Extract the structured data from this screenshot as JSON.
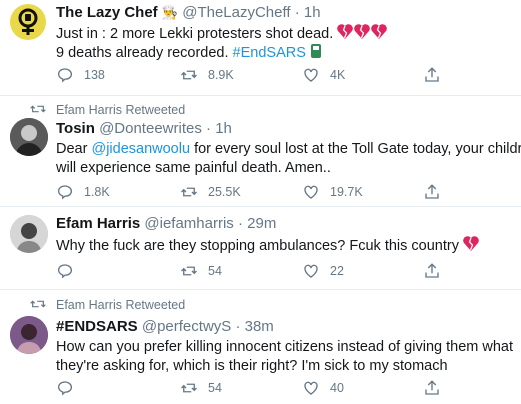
{
  "tweets": [
    {
      "name": "The Lazy Chef",
      "chef_glyph": "👨‍🍳",
      "handle": "@TheLazyCheff",
      "dot": "·",
      "time": "1h",
      "line1": "Just in : 2 more Lekki protesters shot dead.",
      "line2_plain": "9 deaths already recorded.",
      "line2_tag": "#EndSARS",
      "reply_count": "138",
      "retweet_count": "8.9K",
      "like_count": "4K"
    },
    {
      "retweeted_by": "Efam Harris Retweeted",
      "name": "Tosin",
      "handle": "@Donteewrites",
      "dot": "·",
      "time": "1h",
      "line1_prefix": "Dear",
      "line1_mention": "@jidesanwoolu",
      "line1_suffix": "for every soul lost at the Toll Gate today, your children",
      "line2": "will experience same painful death. Amen..",
      "reply_count": "1.8K",
      "retweet_count": "25.5K",
      "like_count": "19.7K"
    },
    {
      "name": "Efam Harris",
      "handle": "@iefamharris",
      "dot": "·",
      "time": "29m",
      "line1": "Why the fuck are they stopping ambulances? Fcuk this country",
      "retweet_count": "54",
      "like_count": "22"
    },
    {
      "retweeted_by": "Efam Harris Retweeted",
      "name": "#ENDSARS",
      "handle": "@perfectwyS",
      "dot": "·",
      "time": "38m",
      "line1": "How can you prefer killing innocent citizens instead of giving them what",
      "line2": "they're asking for, which is their right? I'm sick to my stomach",
      "retweet_count": "54",
      "like_count": "40"
    }
  ],
  "colors": {
    "accent": "#1b95e0",
    "muted": "#657786",
    "broken_heart": "#e0245e",
    "divider": "#e6ecf0"
  }
}
